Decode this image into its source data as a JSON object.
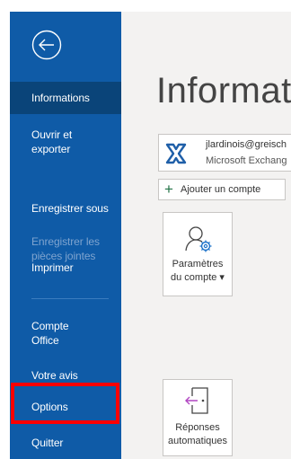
{
  "nav": {
    "items": [
      {
        "label": "Informations"
      },
      {
        "label": "Ouvrir et exporter"
      },
      {
        "label": "Enregistrer sous"
      },
      {
        "label": "Enregistrer les pièces jointes"
      },
      {
        "label": "Imprimer"
      },
      {
        "label": "Compte Office"
      },
      {
        "label": "Votre avis"
      },
      {
        "label": "Options"
      },
      {
        "label": "Quitter"
      }
    ]
  },
  "main": {
    "title": "Informati",
    "account": {
      "email": "jlardinois@greisch",
      "type": "Microsoft Exchang"
    },
    "add_account_label": "Ajouter un compte",
    "tiles": [
      {
        "line1": "Paramètres",
        "line2": "du compte ▾"
      },
      {
        "line1": "Réponses",
        "line2": "automatiques"
      }
    ]
  },
  "colors": {
    "sidebar": "#0f5ba7",
    "sidebar_active": "#0a4479",
    "highlight": "#ff0000"
  }
}
